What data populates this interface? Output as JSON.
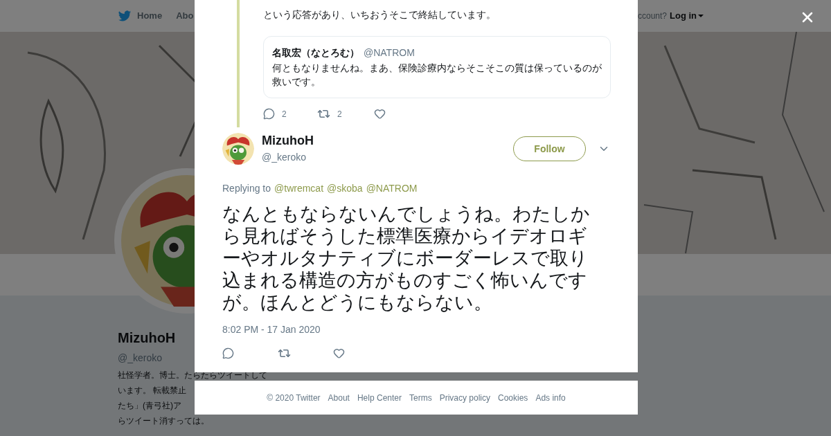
{
  "nav": {
    "items": [
      {
        "label": "Home"
      },
      {
        "label": "Abo"
      }
    ],
    "account_prompt": "ccount?",
    "login": "Log in"
  },
  "profile": {
    "name": "MizuhoH",
    "handle": "@_keroko",
    "bio_lines": [
      "社怪学者。博士。たらたらツイートして",
      "います。 転載禁止",
      "たち」(青弓社)ア",
      "らツイート消すっては。"
    ]
  },
  "modal": {
    "thread_text": "という応答があり、いちおうそこで終結しています。",
    "quote": {
      "name": "名取宏（なとろむ）",
      "handle": "@NATROM",
      "text": "何ともなりませんね。まあ、保険診療内ならそこそこの質は保っているのが救いです。"
    },
    "thread_actions": {
      "replies": "2",
      "retweets": "2"
    },
    "tweet": {
      "name": "MizuhoH",
      "handle": "@_keroko",
      "follow": "Follow",
      "replying_label": "Replying to",
      "mentions": [
        "@twremcat",
        "@skoba",
        "@NATROM"
      ],
      "text": "なんともならないんでしょうね。わたしから見ればそうした標準医療からイデオロギーやオルタナティブにボーダーレスで取り込まれる構造の方がものすごく怖いんですが。ほんとどうにもならない。",
      "timestamp": "8:02 PM - 17 Jan 2020"
    }
  },
  "footer": [
    "© 2020 Twitter",
    "About",
    "Help Center",
    "Terms",
    "Privacy policy",
    "Cookies",
    "Ads info"
  ]
}
